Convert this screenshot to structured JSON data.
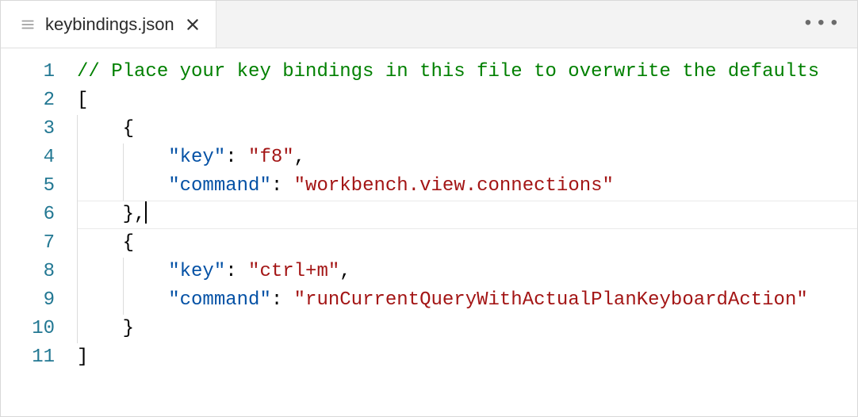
{
  "tab": {
    "file_icon": "list-icon",
    "filename": "keybindings.json",
    "close_label": "×",
    "more_label": "•••"
  },
  "editor": {
    "active_line_index": 5,
    "line_numbers": [
      "1",
      "2",
      "3",
      "4",
      "5",
      "6",
      "7",
      "8",
      "9",
      "10",
      "11"
    ],
    "lines": {
      "l1": {
        "comment": "// Place your key bindings in this file to overwrite the defaults"
      },
      "l2": {
        "punct": "["
      },
      "l3": {
        "punct_open": "{"
      },
      "l4": {
        "key": "\"key\"",
        "colon": ": ",
        "value": "\"f8\"",
        "trail": ","
      },
      "l5": {
        "key": "\"command\"",
        "colon": ": ",
        "value": "\"workbench.view.connections\""
      },
      "l6": {
        "punct_close": "},"
      },
      "l7": {
        "punct_open": "{"
      },
      "l8": {
        "key": "\"key\"",
        "colon": ": ",
        "value": "\"ctrl+m\"",
        "trail": ","
      },
      "l9": {
        "key": "\"command\"",
        "colon": ": ",
        "value": "\"runCurrentQueryWithActualPlanKeyboardAction\""
      },
      "l10": {
        "punct_close": "}"
      },
      "l11": {
        "punct": "]"
      }
    }
  }
}
